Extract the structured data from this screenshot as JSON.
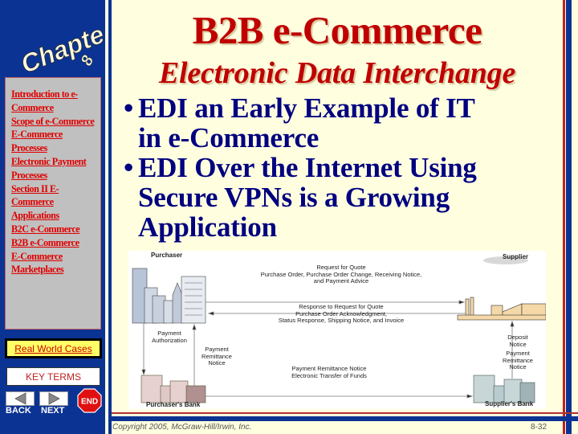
{
  "sidebar": {
    "logo_text": "Chapter",
    "chapter_number": "8",
    "nav_links": [
      {
        "label": "Introduction to e-Commerce"
      },
      {
        "label": "Scope of e-Commerce"
      },
      {
        "label": "E-Commerce Processes"
      },
      {
        "label": "Electronic Payment Processes"
      },
      {
        "label": "Section II E-Commerce Applications"
      },
      {
        "label": "B2C e-Commerce"
      },
      {
        "label": "B2B e-Commerce"
      },
      {
        "label": "E-Commerce Marketplaces"
      }
    ],
    "real_world_cases_label": "Real World Cases",
    "key_terms_label": "KEY TERMS",
    "back_label": "BACK",
    "next_label": "NEXT",
    "end_label": "END"
  },
  "slide": {
    "title": "B2B e-Commerce",
    "subtitle": "Electronic Data Interchange",
    "bullets": [
      {
        "line1": "EDI an Early Example of IT",
        "line2": "in e-Commerce"
      },
      {
        "line1": "EDI Over the Internet Using",
        "line2": "Secure VPNs is a Growing",
        "line3": "Application"
      }
    ],
    "bullet_glyph": "•"
  },
  "diagram": {
    "purchaser": "Purchaser",
    "supplier": "Supplier",
    "purchasers_bank": "Purchaser's Bank",
    "suppliers_bank": "Supplier's Bank",
    "request_lines": [
      "Request for Quote",
      "Purchase Order, Purchase Order Change, Receiving Notice,",
      "and Payment Advice"
    ],
    "response_lines": [
      "Response to Request for Quote",
      "Purchase Order Acknowledgment,",
      "Status Response, Shipping Notice, and Invoice"
    ],
    "payment_authorization": [
      "Payment",
      "Authorization"
    ],
    "payment_remittance_left": [
      "Payment",
      "Remittance",
      "Notice"
    ],
    "transfer_lines": [
      "Payment Remittance Notice",
      "Electronic Transfer of Funds"
    ],
    "deposit_notice": [
      "Deposit",
      "Notice"
    ],
    "payment_remittance_right": [
      "Payment",
      "Remittance",
      "Notice"
    ]
  },
  "footer": {
    "copyright": "Copyright 2005, McGraw-Hill/Irwin, Inc.",
    "page_number": "8-32"
  },
  "colors": {
    "sidebar_blue": "#0B3394",
    "title_red": "#C00000",
    "bullet_navy": "#000080",
    "background": "#FFFFE0"
  }
}
